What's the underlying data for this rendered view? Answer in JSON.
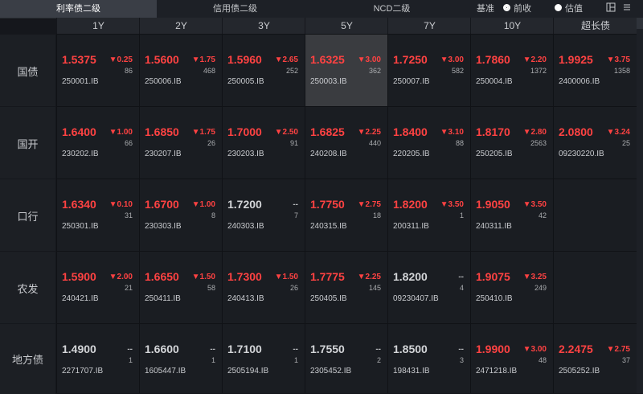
{
  "tabs": [
    "利率债二级",
    "信用债二级",
    "NCD二级"
  ],
  "base_label": "基准",
  "radio_options": [
    "前收",
    "估值"
  ],
  "radio_selected": "前收",
  "toolbar_icons": [
    "layout-icon",
    "menu-icon"
  ],
  "columns": [
    "1Y",
    "2Y",
    "3Y",
    "5Y",
    "7Y",
    "10Y",
    "超长债"
  ],
  "rows": [
    {
      "label": "国债",
      "cells": [
        {
          "price": "1.5375",
          "change": "▼0.25",
          "volume": "86",
          "code": "250001.IB",
          "dir": "up"
        },
        {
          "price": "1.5600",
          "change": "▼1.75",
          "volume": "468",
          "code": "250006.IB",
          "dir": "up"
        },
        {
          "price": "1.5960",
          "change": "▼2.65",
          "volume": "252",
          "code": "250005.IB",
          "dir": "up"
        },
        {
          "price": "1.6325",
          "change": "▼3.00",
          "volume": "362",
          "code": "250003.IB",
          "dir": "up",
          "selected": true
        },
        {
          "price": "1.7250",
          "change": "▼3.00",
          "volume": "582",
          "code": "250007.IB",
          "dir": "up"
        },
        {
          "price": "1.7860",
          "change": "▼2.20",
          "volume": "1372",
          "code": "250004.IB",
          "dir": "up"
        },
        {
          "price": "1.9925",
          "change": "▼3.75",
          "volume": "1358",
          "code": "2400006.IB",
          "dir": "up"
        }
      ]
    },
    {
      "label": "国开",
      "cells": [
        {
          "price": "1.6400",
          "change": "▼1.00",
          "volume": "66",
          "code": "230202.IB",
          "dir": "up"
        },
        {
          "price": "1.6850",
          "change": "▼1.75",
          "volume": "26",
          "code": "230207.IB",
          "dir": "up"
        },
        {
          "price": "1.7000",
          "change": "▼2.50",
          "volume": "91",
          "code": "230203.IB",
          "dir": "up"
        },
        {
          "price": "1.6825",
          "change": "▼2.25",
          "volume": "440",
          "code": "240208.IB",
          "dir": "up"
        },
        {
          "price": "1.8400",
          "change": "▼3.10",
          "volume": "88",
          "code": "220205.IB",
          "dir": "up"
        },
        {
          "price": "1.8170",
          "change": "▼2.80",
          "volume": "2563",
          "code": "250205.IB",
          "dir": "up"
        },
        {
          "price": "2.0800",
          "change": "▼3.24",
          "volume": "25",
          "code": "09230220.IB",
          "dir": "up"
        }
      ]
    },
    {
      "label": "口行",
      "cells": [
        {
          "price": "1.6340",
          "change": "▼0.10",
          "volume": "31",
          "code": "250301.IB",
          "dir": "up"
        },
        {
          "price": "1.6700",
          "change": "▼1.00",
          "volume": "8",
          "code": "230303.IB",
          "dir": "up"
        },
        {
          "price": "1.7200",
          "change": "--",
          "volume": "7",
          "code": "240303.IB",
          "dir": "flat"
        },
        {
          "price": "1.7750",
          "change": "▼2.75",
          "volume": "18",
          "code": "240315.IB",
          "dir": "up"
        },
        {
          "price": "1.8200",
          "change": "▼3.50",
          "volume": "1",
          "code": "200311.IB",
          "dir": "up"
        },
        {
          "price": "1.9050",
          "change": "▼3.50",
          "volume": "42",
          "code": "240311.IB",
          "dir": "up"
        },
        null
      ]
    },
    {
      "label": "农发",
      "cells": [
        {
          "price": "1.5900",
          "change": "▼2.00",
          "volume": "21",
          "code": "240421.IB",
          "dir": "up"
        },
        {
          "price": "1.6650",
          "change": "▼1.50",
          "volume": "58",
          "code": "250411.IB",
          "dir": "up"
        },
        {
          "price": "1.7300",
          "change": "▼1.50",
          "volume": "26",
          "code": "240413.IB",
          "dir": "up"
        },
        {
          "price": "1.7775",
          "change": "▼2.25",
          "volume": "145",
          "code": "250405.IB",
          "dir": "up"
        },
        {
          "price": "1.8200",
          "change": "--",
          "volume": "4",
          "code": "09230407.IB",
          "dir": "flat"
        },
        {
          "price": "1.9075",
          "change": "▼3.25",
          "volume": "249",
          "code": "250410.IB",
          "dir": "up"
        },
        null
      ]
    },
    {
      "label": "地方债",
      "cells": [
        {
          "price": "1.4900",
          "change": "--",
          "volume": "1",
          "code": "2271707.IB",
          "dir": "flat"
        },
        {
          "price": "1.6600",
          "change": "--",
          "volume": "1",
          "code": "1605447.IB",
          "dir": "flat"
        },
        {
          "price": "1.7100",
          "change": "--",
          "volume": "1",
          "code": "2505194.IB",
          "dir": "flat"
        },
        {
          "price": "1.7550",
          "change": "--",
          "volume": "2",
          "code": "2305452.IB",
          "dir": "flat"
        },
        {
          "price": "1.8500",
          "change": "--",
          "volume": "3",
          "code": "198431.IB",
          "dir": "flat"
        },
        {
          "price": "1.9900",
          "change": "▼3.00",
          "volume": "48",
          "code": "2471218.IB",
          "dir": "up"
        },
        {
          "price": "2.2475",
          "change": "▼2.75",
          "volume": "37",
          "code": "2505252.IB",
          "dir": "up"
        }
      ]
    }
  ],
  "colors": {
    "up": "#ff4242",
    "flat": "#d3d5d8",
    "selected": "#3a3c40"
  }
}
